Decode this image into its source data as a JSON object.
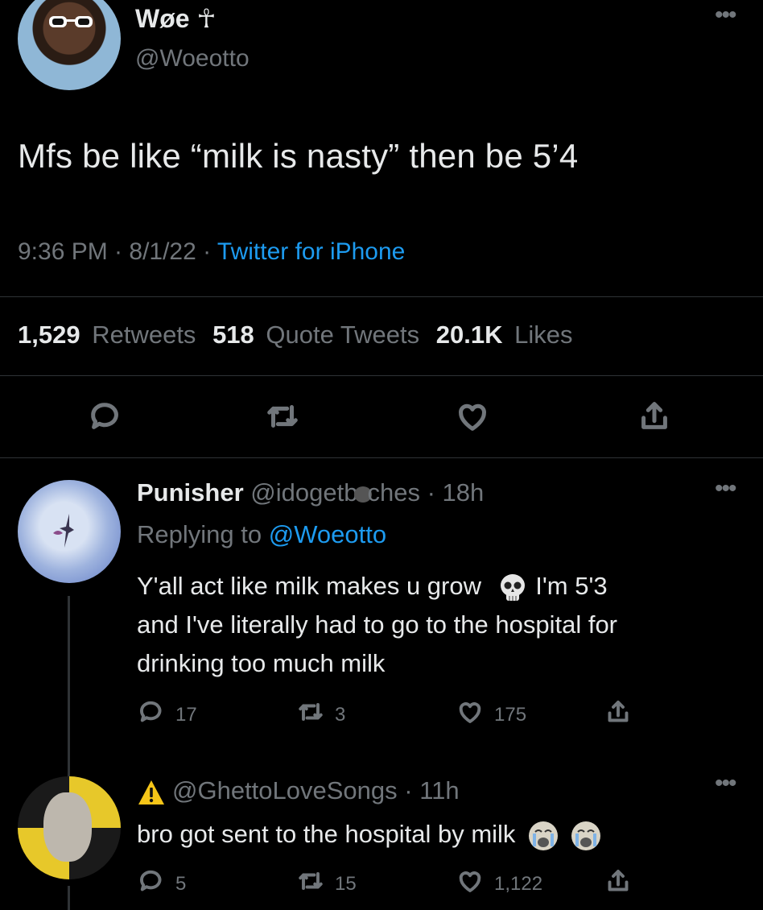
{
  "main_tweet": {
    "display_name": "Wøe ☥",
    "handle": "@Woeotto",
    "text": "Mfs be like “milk is nasty” then be 5’4",
    "time": "9:36 PM · 8/1/22 · ",
    "source": "Twitter for iPhone",
    "retweets_count": "1,529",
    "retweets_label": "Retweets",
    "quotes_count": "518",
    "quotes_label": "Quote Tweets",
    "likes_count": "20.1K",
    "likes_label": "Likes"
  },
  "reply1": {
    "display_name": "Punisher",
    "handle": "@idogetb",
    "handle_end": "ches",
    "age": " · 18h",
    "replying_prefix": "Replying to ",
    "replying_to": "@Woeotto",
    "text_line1_a": "Y'all act like milk makes u grow",
    "text_line1_b": " I'm 5'3",
    "text_line2": "and I've literally had to go to the hospital for",
    "text_line3": "drinking too much milk",
    "replies": "17",
    "retweets": "3",
    "likes": "175"
  },
  "reply2": {
    "handle": "@GhettoLoveSongs",
    "age": " · 11h",
    "text": "bro got sent to the hospital by milk",
    "replies": "5",
    "retweets": "15",
    "likes": "1,122"
  },
  "icons": [
    "reply-icon",
    "retweet-icon",
    "like-icon",
    "share-icon",
    "more-icon",
    "skull-emoji",
    "crying-emoji",
    "warning-icon"
  ],
  "colors": {
    "background": "#000000",
    "text": "#e7e9ea",
    "muted": "#71767b",
    "link": "#1d9bf0"
  }
}
